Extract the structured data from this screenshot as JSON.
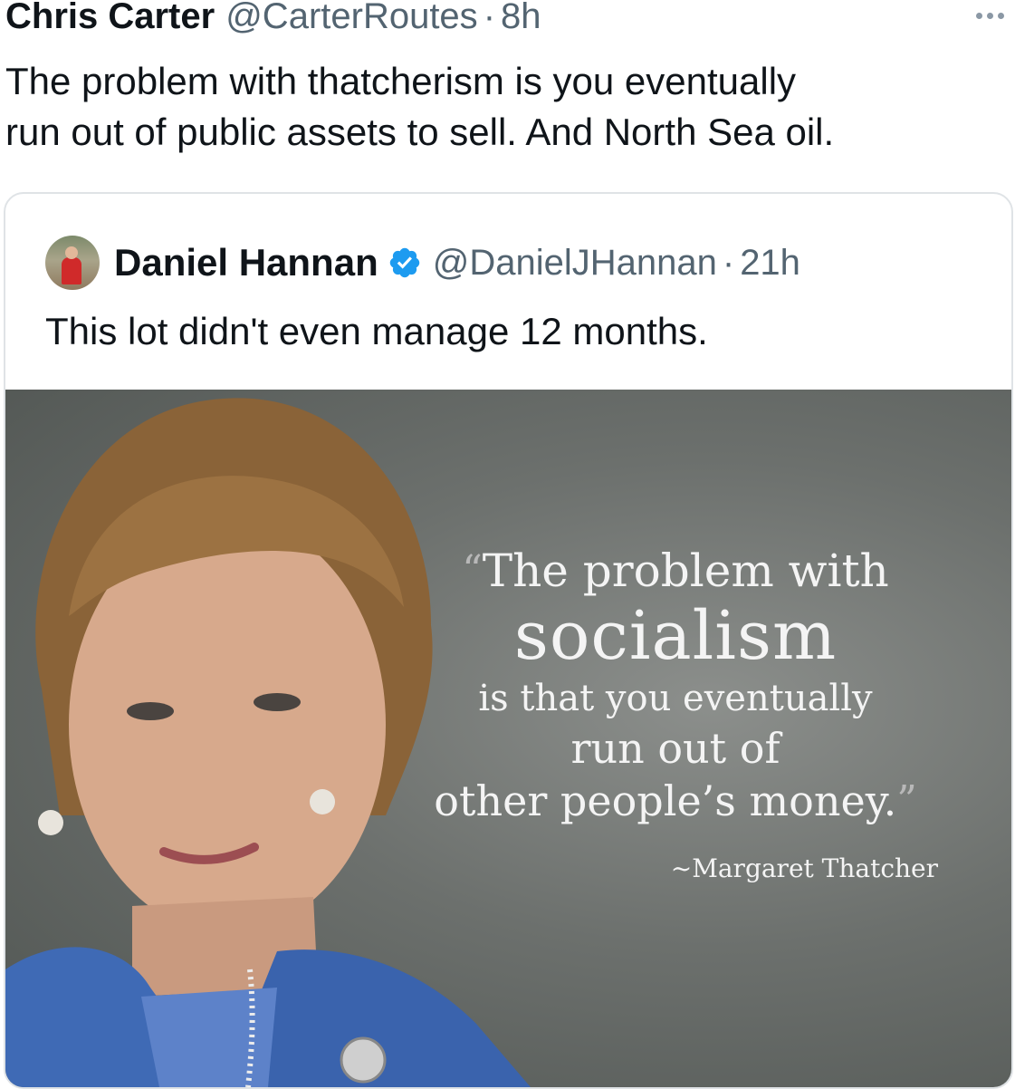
{
  "tweet": {
    "author_name": "Chris Carter",
    "author_handle": "@CarterRoutes",
    "separator": "·",
    "time": "8h",
    "more_icon": "more-dots-icon",
    "text_line1": "The problem with thatcherism is you eventually",
    "text_line2": "run out of public assets to sell. And North Sea oil."
  },
  "quoted_tweet": {
    "avatar_icon": "avatar-photo",
    "author_name": "Daniel Hannan",
    "verified_icon": "verified-badge-icon",
    "author_handle": "@DanielJHannan",
    "separator": "·",
    "time": "21h",
    "text": "This lot didn't even manage 12 months.",
    "image": {
      "quote_open": "“",
      "quote_line1": "The problem with",
      "quote_line2": "socialism",
      "quote_line3": "is that you eventually",
      "quote_line4": "run out of",
      "quote_line5": "other people’s money.",
      "quote_close": "”",
      "attribution": "~Margaret Thatcher"
    }
  },
  "colors": {
    "text_primary": "#0f1419",
    "text_secondary": "#536471",
    "verified_blue": "#1d9bf0",
    "card_border": "#dfe3e6"
  }
}
